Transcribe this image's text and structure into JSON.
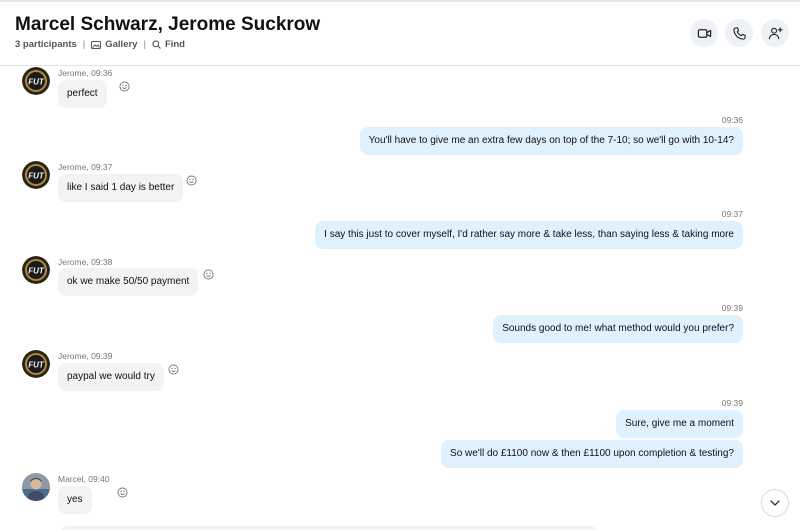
{
  "header": {
    "title": "Marcel Schwarz, Jerome Suckrow",
    "participants": "3 participants",
    "separator": "|",
    "gallery_label": "Gallery",
    "find_label": "Find"
  },
  "avatars": {
    "jerome_badge_text": "FUT"
  },
  "messages": [
    {
      "direction": "incoming",
      "sender_time": "Jerome, 09:36",
      "text": "perfect"
    },
    {
      "direction": "outgoing",
      "time": "09:36",
      "text": "You'll have to give me an extra few days on top of the 7-10; so we'll go with 10-14?"
    },
    {
      "direction": "incoming",
      "sender_time": "Jerome, 09:37",
      "text": "like I said 1 day is better"
    },
    {
      "direction": "outgoing",
      "time": "09:37",
      "text": "I say this just to cover myself, I'd rather say more & take less, than saying less & taking more"
    },
    {
      "direction": "incoming",
      "sender_time": "Jerome, 09:38",
      "text": "ok we make 50/50 payment"
    },
    {
      "direction": "outgoing",
      "time": "09:39",
      "text": "Sounds good to me! what method would you prefer?"
    },
    {
      "direction": "incoming",
      "sender_time": "Jerome, 09:39",
      "text": "paypal we would try"
    },
    {
      "direction": "outgoing",
      "time": "09:39",
      "text": "Sure, give me a moment"
    },
    {
      "direction": "outgoing",
      "time": "",
      "text": "So we'll do £1100 now & then £1100 upon completion & testing?"
    },
    {
      "direction": "incoming",
      "sender_time": "Marcel, 09:40",
      "text": "yes"
    }
  ],
  "colors": {
    "incoming_bubble": "#f2f3f5",
    "outgoing_bubble": "#dff1fc",
    "header_button_bg": "#eef1f5"
  }
}
